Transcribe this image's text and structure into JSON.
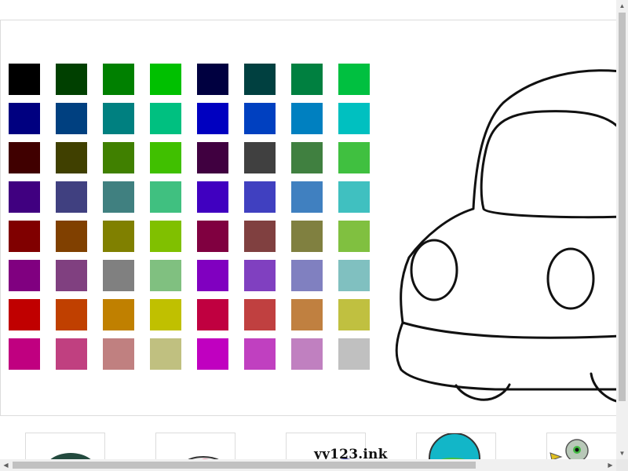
{
  "palette": {
    "colors": [
      [
        "#000000",
        "#004000",
        "#008000",
        "#00c000",
        "#000040",
        "#004040",
        "#008040",
        "#00c040"
      ],
      [
        "#000080",
        "#004080",
        "#008080",
        "#00c080",
        "#0000c0",
        "#0040c0",
        "#0080c0",
        "#00c0c0"
      ],
      [
        "#400000",
        "#404000",
        "#408000",
        "#40c000",
        "#400040",
        "#404040",
        "#408040",
        "#40c040"
      ],
      [
        "#400080",
        "#404080",
        "#408080",
        "#40c080",
        "#4000c0",
        "#4040c0",
        "#4080c0",
        "#40c0c0"
      ],
      [
        "#800000",
        "#804000",
        "#808000",
        "#80c000",
        "#800040",
        "#804040",
        "#808040",
        "#80c040"
      ],
      [
        "#800080",
        "#804080",
        "#808080",
        "#80c080",
        "#8000c0",
        "#8040c0",
        "#8080c0",
        "#80c0c0"
      ],
      [
        "#c00000",
        "#c04000",
        "#c08000",
        "#c0c000",
        "#c00040",
        "#c04040",
        "#c08040",
        "#c0c040"
      ],
      [
        "#c00080",
        "#c04080",
        "#c08080",
        "#c0c080",
        "#c000c0",
        "#c040c0",
        "#c080c0",
        "#c0c0c0"
      ]
    ]
  },
  "canvas": {
    "drawing": "car-outline",
    "outline_color": "#111111",
    "fill_color": "#ffffff"
  },
  "thumbnails": [
    {
      "name": "thumbnail-1"
    },
    {
      "name": "thumbnail-2"
    },
    {
      "name": "thumbnail-3"
    },
    {
      "name": "thumbnail-4"
    },
    {
      "name": "thumbnail-5"
    }
  ],
  "watermark": {
    "text": "yy123.ink"
  },
  "scrollbars": {
    "up_icon": "arrow-up-icon",
    "down_icon": "arrow-down-icon",
    "left_icon": "arrow-left-icon",
    "right_icon": "arrow-right-icon"
  }
}
